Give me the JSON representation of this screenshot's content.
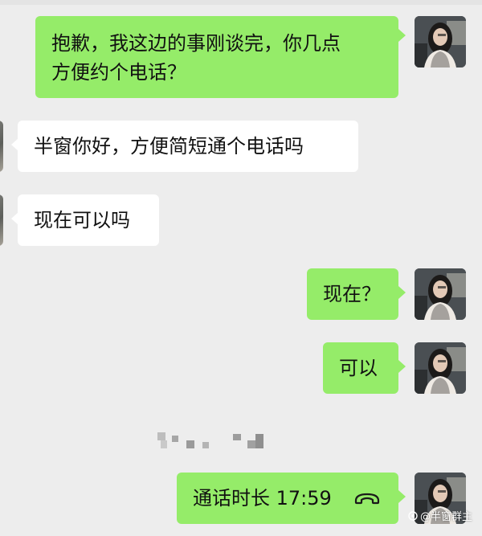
{
  "chat": {
    "messages": [
      {
        "sender": "me",
        "lines": [
          "抱歉，我这边的事刚谈完，你几点",
          "方便约个电话？"
        ]
      },
      {
        "sender": "other",
        "text": "半窗你好，方便简短通个电话吗"
      },
      {
        "sender": "other",
        "text": "现在可以吗"
      },
      {
        "sender": "me",
        "text": "现在？"
      },
      {
        "sender": "me",
        "text": "可以"
      },
      {
        "sender": "me",
        "text": "通话时长 17:59",
        "icon": "phone-hangup-icon"
      }
    ]
  },
  "watermark": {
    "text": "@半窗群主",
    "icon": "logo-icon"
  },
  "colors": {
    "background": "#ededed",
    "my_bubble": "#95ec69",
    "other_bubble": "#ffffff",
    "text": "#111111"
  }
}
